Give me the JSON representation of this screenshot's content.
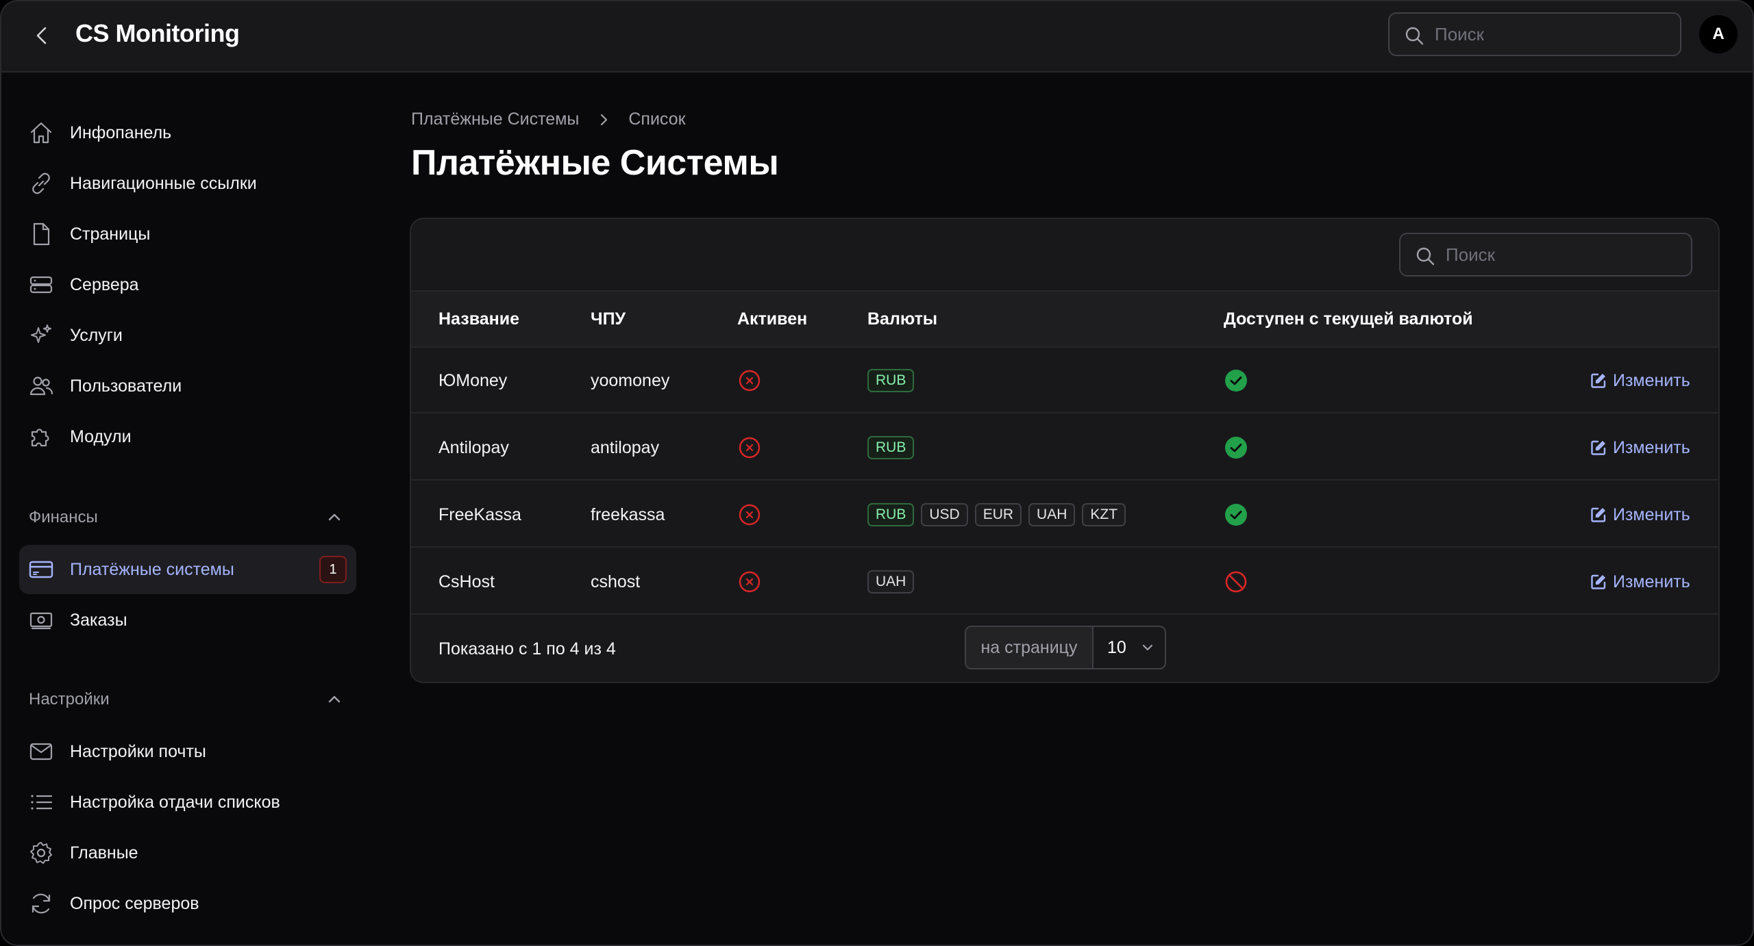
{
  "header": {
    "title": "CS Monitoring",
    "search_placeholder": "Поиск",
    "avatar_initial": "A"
  },
  "sidebar": {
    "items": [
      {
        "label": "Инфопанель",
        "icon": "home-icon"
      },
      {
        "label": "Навигационные ссылки",
        "icon": "link-icon"
      },
      {
        "label": "Страницы",
        "icon": "document-icon"
      },
      {
        "label": "Сервера",
        "icon": "server-icon"
      },
      {
        "label": "Услуги",
        "icon": "sparkles-icon"
      },
      {
        "label": "Пользователи",
        "icon": "users-icon"
      },
      {
        "label": "Модули",
        "icon": "puzzle-icon"
      }
    ],
    "groups": [
      {
        "label": "Финансы",
        "items": [
          {
            "label": "Платёжные системы",
            "icon": "credit-card-icon",
            "active": true,
            "badge": "1"
          },
          {
            "label": "Заказы",
            "icon": "banknote-icon"
          }
        ]
      },
      {
        "label": "Настройки",
        "items": [
          {
            "label": "Настройки почты",
            "icon": "envelope-icon"
          },
          {
            "label": "Настройка отдачи списков",
            "icon": "list-icon"
          },
          {
            "label": "Главные",
            "icon": "gear-icon"
          },
          {
            "label": "Опрос серверов",
            "icon": "refresh-icon"
          }
        ]
      }
    ]
  },
  "breadcrumb": [
    "Платёжные Системы",
    "Список"
  ],
  "page_title": "Платёжные Системы",
  "table": {
    "search_placeholder": "Поиск",
    "columns": [
      "Название",
      "ЧПУ",
      "Активен",
      "Валюты",
      "Доступен с текущей валютой"
    ],
    "rows": [
      {
        "name": "ЮMoney",
        "slug": "yoomoney",
        "active": false,
        "currencies": [
          "RUB"
        ],
        "available": true,
        "action": "Изменить"
      },
      {
        "name": "Antilopay",
        "slug": "antilopay",
        "active": false,
        "currencies": [
          "RUB"
        ],
        "available": true,
        "action": "Изменить"
      },
      {
        "name": "FreeKassa",
        "slug": "freekassa",
        "active": false,
        "currencies": [
          "RUB",
          "USD",
          "EUR",
          "UAH",
          "KZT"
        ],
        "available": true,
        "action": "Изменить"
      },
      {
        "name": "CsHost",
        "slug": "cshost",
        "active": false,
        "currencies": [
          "UAH"
        ],
        "available": false,
        "action": "Изменить"
      }
    ],
    "footer": {
      "info": "Показано с 1 по 4 из 4",
      "per_page_label": "на страницу",
      "per_page_value": "10"
    }
  },
  "colors": {
    "accent": "#a5b4fc",
    "success": "#22a04a",
    "danger": "#dc2626",
    "background": "#09090b",
    "surface": "#18181b"
  }
}
